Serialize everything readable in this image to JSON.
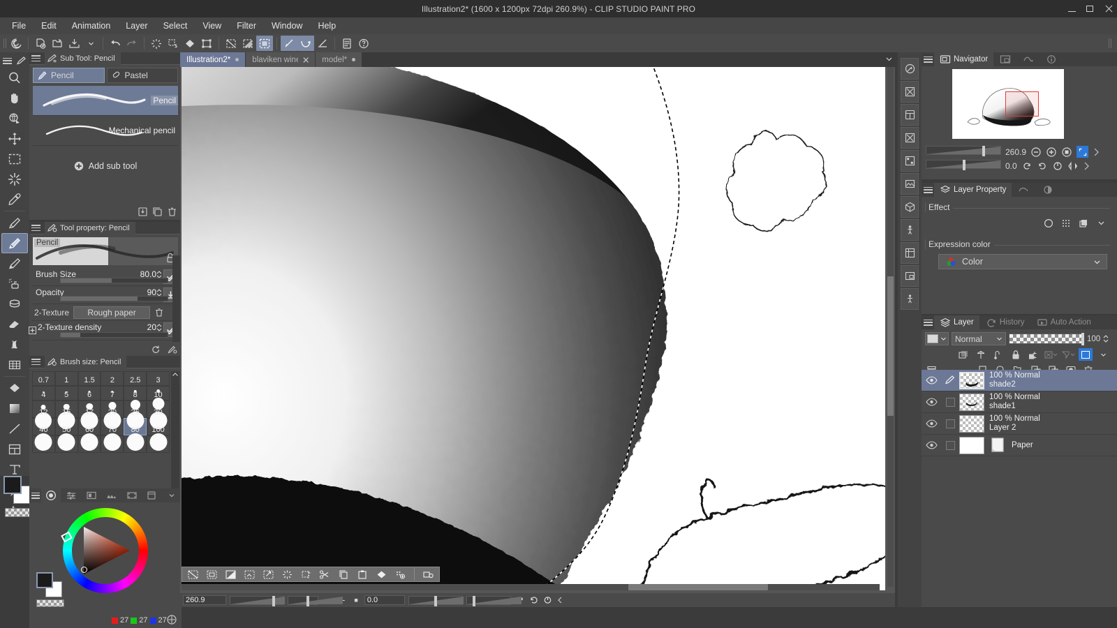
{
  "window": {
    "title": "Illustration2* (1600 x 1200px 72dpi 260.9%)  - CLIP STUDIO PAINT PRO",
    "minimize": "minimize-button",
    "maximize": "maximize-button",
    "close": "close-button"
  },
  "menu": {
    "items": [
      "File",
      "Edit",
      "Animation",
      "Layer",
      "Select",
      "View",
      "Filter",
      "Window",
      "Help"
    ]
  },
  "command_bar": {
    "buttons": [
      {
        "name": "clip-studio-button",
        "icon": "spiral-icon"
      },
      {
        "name": "new-button",
        "icon": "new-doc-icon"
      },
      {
        "name": "open-button",
        "icon": "folder-open-icon"
      },
      {
        "name": "save-button",
        "icon": "save-icon"
      },
      {
        "name": "save-dropdown",
        "icon": "chevron-down-icon"
      },
      {
        "name": "undo-button",
        "icon": "undo-icon"
      },
      {
        "name": "redo-button",
        "icon": "redo-icon"
      },
      {
        "name": "clear-button",
        "icon": "burst-icon"
      },
      {
        "name": "fill-selection-button",
        "icon": "fill-select-icon"
      },
      {
        "name": "fill-button",
        "icon": "diamond-fill-icon"
      },
      {
        "name": "scale-rotate-button",
        "icon": "transform-icon"
      },
      {
        "name": "deselect-button",
        "icon": "deselect-icon"
      },
      {
        "name": "invert-selection-button",
        "icon": "invert-select-icon"
      },
      {
        "name": "select-border-button",
        "icon": "select-border-icon"
      },
      {
        "name": "snap-ruler-button",
        "icon": "snap-ruler-icon"
      },
      {
        "name": "snap-curve-button",
        "icon": "snap-curve-icon"
      },
      {
        "name": "snap-perspective-button",
        "icon": "snap-perspective-icon"
      },
      {
        "name": "grid-button",
        "icon": "grid-icon"
      },
      {
        "name": "help-button",
        "icon": "question-icon"
      }
    ]
  },
  "tools": {
    "header_label": "tool-palette",
    "items": [
      {
        "name": "magnifier-tool",
        "icon": "magnifier-icon"
      },
      {
        "name": "move-layer-tool",
        "icon": "hand-icon"
      },
      {
        "name": "rotate-tool",
        "icon": "rotate-icon"
      },
      {
        "name": "move-tool",
        "icon": "move-arrows-icon"
      },
      {
        "name": "selection-tool",
        "icon": "marquee-icon"
      },
      {
        "name": "auto-select-tool",
        "icon": "magic-wand-icon"
      },
      {
        "name": "eyedropper-tool",
        "icon": "eyedropper-icon"
      },
      {
        "name": "pen-tool",
        "icon": "pen-icon"
      },
      {
        "name": "pencil-tool",
        "icon": "pencil-icon",
        "selected": true
      },
      {
        "name": "brush-tool",
        "icon": "brush-icon"
      },
      {
        "name": "airbrush-tool",
        "icon": "airbrush-icon"
      },
      {
        "name": "decoration-tool",
        "icon": "decoration-icon"
      },
      {
        "name": "eraser-tool",
        "icon": "eraser-icon"
      },
      {
        "name": "blend-tool",
        "icon": "blend-icon"
      },
      {
        "name": "gradient-tool",
        "icon": "gradient-grid-icon"
      },
      {
        "name": "fill-tool",
        "icon": "fill-bucket-icon"
      },
      {
        "name": "gradation-tool",
        "icon": "gradation-icon"
      },
      {
        "name": "figure-tool",
        "icon": "line-icon"
      },
      {
        "name": "frame-border-tool",
        "icon": "frame-icon"
      },
      {
        "name": "text-tool",
        "icon": "text-icon"
      },
      {
        "name": "balloon-tool",
        "icon": "balloon-icon"
      },
      {
        "name": "correct-line-tool",
        "icon": "correct-line-icon"
      }
    ]
  },
  "sub_tool": {
    "title": "Sub Tool: Pencil",
    "tabs": [
      {
        "label": "Pencil",
        "icon": "pencil-icon",
        "active": true
      },
      {
        "label": "Pastel",
        "icon": "pastel-icon",
        "active": false
      }
    ],
    "list": [
      {
        "label": "Pencil",
        "selected": true
      },
      {
        "label": "Mechanical pencil",
        "selected": false
      }
    ],
    "add_label": "Add sub tool",
    "footer": [
      {
        "name": "import-subtool-button",
        "icon": "import-icon"
      },
      {
        "name": "duplicate-subtool-button",
        "icon": "duplicate-icon"
      },
      {
        "name": "delete-subtool-button",
        "icon": "trash-icon"
      }
    ]
  },
  "tool_property": {
    "title": "Tool property: Pencil",
    "preview_label": "Pencil",
    "rows": [
      {
        "name": "Brush Size",
        "value": "80.0",
        "fill_pct": 48
      },
      {
        "name": "Opacity",
        "value": "90",
        "fill_pct": 72
      }
    ],
    "texture_label": "2-Texture",
    "texture_value": "Rough paper",
    "density_label": "2-Texture density",
    "density_value": "20",
    "density_fill_pct": 18
  },
  "brush_size": {
    "title": "Brush size: Pencil",
    "rows": [
      {
        "values": [
          "0.7",
          "1",
          "1.5",
          "2",
          "2.5",
          "3"
        ],
        "dots": [
          0,
          0,
          0,
          0,
          0,
          0
        ]
      },
      {
        "values": [
          "4",
          "5",
          "6",
          "7",
          "8",
          "10"
        ],
        "dots": [
          2,
          2.5,
          3,
          3.5,
          4.5,
          5.5
        ]
      },
      {
        "values": [
          "12",
          "15",
          "17",
          "20",
          "25",
          "30"
        ],
        "dots": [
          7,
          8.5,
          9.5,
          11,
          14,
          17
        ]
      },
      {
        "values": [
          "40",
          "50",
          "60",
          "70",
          "80",
          "100"
        ],
        "dots": [
          21,
          22,
          22,
          22,
          22,
          22
        ]
      },
      {
        "values": [
          "",
          "",
          "",
          "",
          "",
          ""
        ],
        "dots": [
          22,
          22,
          22,
          22,
          22,
          22
        ]
      }
    ],
    "selected": "80"
  },
  "color_wheel": {
    "tabs": [
      {
        "name": "color-wheel-tab",
        "icon": "color-wheel-icon",
        "active": true
      },
      {
        "name": "color-slider-tab",
        "icon": "sliders-icon",
        "active": false
      },
      {
        "name": "color-set-tab",
        "icon": "color-set-icon",
        "active": false
      },
      {
        "name": "gradient-tab",
        "icon": "mountain-icon",
        "active": false
      },
      {
        "name": "color-history-tab",
        "icon": "filmstrip-icon",
        "active": false
      },
      {
        "name": "material-tab",
        "icon": "material-icon",
        "active": false
      }
    ],
    "rgb": {
      "r": "27",
      "g": "27",
      "b": "27"
    },
    "foreground_color": "#1b1b1b",
    "background_color": "#ffffff"
  },
  "document_tabs": [
    {
      "label": "Illustration2*",
      "active": true,
      "modified": true,
      "closable": false
    },
    {
      "label": "blaviken wine.p",
      "active": false,
      "modified": false,
      "closable": true
    },
    {
      "label": "model*",
      "active": false,
      "modified": true,
      "closable": false
    }
  ],
  "selection_launcher": [
    {
      "name": "deselect-button",
      "icon": "deselect-icon"
    },
    {
      "name": "invert-selection-button",
      "icon": "invert-icon"
    },
    {
      "name": "shrink-expand-button",
      "icon": "shrink-icon"
    },
    {
      "name": "crop-button",
      "icon": "crop-icon"
    },
    {
      "name": "scale-up-button",
      "icon": "scale-icon"
    },
    {
      "name": "blur-button",
      "icon": "burst-icon"
    },
    {
      "name": "erase-button",
      "icon": "erase-icon"
    },
    {
      "name": "cut-button",
      "icon": "scissors-icon"
    },
    {
      "name": "copy-button",
      "icon": "copy-icon"
    },
    {
      "name": "paste-button",
      "icon": "paste-icon"
    },
    {
      "name": "fill-button",
      "icon": "diamond-icon"
    },
    {
      "name": "add-tone-button",
      "icon": "tone-icon"
    },
    {
      "name": "settings-button",
      "icon": "gear-icon"
    }
  ],
  "status_bar": {
    "zoom": "260.9",
    "rotation": "0.0",
    "zoom_out": "−",
    "zoom_in": "+",
    "zoom_reset": "■"
  },
  "right_strip": [
    {
      "name": "quick-access-button",
      "icon": "quick-access-icon"
    },
    {
      "name": "material-download-button",
      "icon": "material-dl-icon"
    },
    {
      "name": "material-manga-button",
      "icon": "material-manga-icon"
    },
    {
      "name": "material-monochrome-button",
      "icon": "material-mono-icon"
    },
    {
      "name": "material-color-button",
      "icon": "material-color-icon"
    },
    {
      "name": "material-image-button",
      "icon": "material-image-icon"
    },
    {
      "name": "material-3d-button",
      "icon": "material-3d-icon"
    },
    {
      "name": "material-pose-button",
      "icon": "material-pose-icon"
    },
    {
      "name": "material-all-button",
      "icon": "material-all-icon"
    },
    {
      "name": "sub-view-button",
      "icon": "sub-view-icon"
    },
    {
      "name": "pose-scanner-button",
      "icon": "pose-scanner-icon"
    }
  ],
  "navigator": {
    "tabs": [
      {
        "label": "Navigator",
        "active": true,
        "icon": "navigator-icon"
      },
      {
        "label": "",
        "active": false,
        "icon": "sub-view-icon"
      },
      {
        "label": "",
        "active": false,
        "icon": "timelapse-icon"
      },
      {
        "label": "",
        "active": false,
        "icon": "info-icon"
      }
    ],
    "zoom": "260.9",
    "rotation": "0.0",
    "controls": [
      {
        "name": "zoom-out-button",
        "icon": "minus-circle-icon"
      },
      {
        "name": "zoom-in-button",
        "icon": "plus-circle-icon"
      },
      {
        "name": "fit-button",
        "icon": "fit-icon"
      },
      {
        "name": "full-button",
        "icon": "full-icon"
      },
      {
        "name": "rotate-left-button",
        "icon": "rotate-left-icon"
      },
      {
        "name": "rotate-right-button",
        "icon": "rotate-right-icon"
      },
      {
        "name": "rotate-reset-button",
        "icon": "rotate-reset-icon"
      },
      {
        "name": "flip-button",
        "icon": "flip-icon"
      }
    ]
  },
  "layer_property": {
    "tabs": [
      {
        "label": "Layer Property",
        "active": true,
        "icon": "layer-property-icon"
      },
      {
        "label": "",
        "active": false,
        "icon": "animation-cels-icon"
      },
      {
        "label": "",
        "active": false,
        "icon": "color-mode-icon"
      }
    ],
    "effect_label": "Effect",
    "effect_buttons": [
      {
        "name": "border-effect-button",
        "icon": "circle-icon"
      },
      {
        "name": "tone-effect-button",
        "icon": "halftone-icon"
      },
      {
        "name": "layer-color-button",
        "icon": "layer-color-icon"
      },
      {
        "name": "effect-more-button",
        "icon": "chevron-down-icon"
      }
    ],
    "expression_label": "Expression color",
    "expression_value": "Color"
  },
  "layers": {
    "tabs": [
      {
        "label": "Layer",
        "active": true,
        "icon": "layers-icon"
      },
      {
        "label": "History",
        "active": false,
        "icon": "history-icon"
      },
      {
        "label": "Auto Action",
        "active": false,
        "icon": "auto-action-icon"
      }
    ],
    "blend_mode": "Normal",
    "opacity": "100",
    "toolbar_icons": [
      {
        "name": "clip-to-layer-button",
        "icon": "clip-layer-icon"
      },
      {
        "name": "mask-enable-button",
        "icon": "mask-icon"
      },
      {
        "name": "ruler-range-button",
        "icon": "ruler-range-icon"
      },
      {
        "name": "lock-layer-button",
        "icon": "lock-icon"
      },
      {
        "name": "lock-transparent-button",
        "icon": "lock-transparent-icon"
      },
      {
        "name": "mask-apply-button",
        "icon": "mask-apply-icon"
      },
      {
        "name": "mask-delete-button",
        "icon": "mask-delete-icon"
      },
      {
        "name": "palette-color-button",
        "icon": "palette-color-icon"
      }
    ],
    "toolbar_icons2": [
      {
        "name": "layer-list-button",
        "icon": "layer-list-icon"
      },
      {
        "name": "new-raster-layer-button",
        "icon": "new-raster-icon"
      },
      {
        "name": "new-vector-layer-button",
        "icon": "new-vector-icon"
      },
      {
        "name": "new-folder-button",
        "icon": "new-folder-icon"
      },
      {
        "name": "transfer-down-button",
        "icon": "transfer-down-icon"
      },
      {
        "name": "combine-down-button",
        "icon": "combine-down-icon"
      },
      {
        "name": "create-mask-button",
        "icon": "create-mask-icon"
      },
      {
        "name": "delete-layer-button",
        "icon": "trash-icon"
      }
    ],
    "rows": [
      {
        "mode": "100 % Normal",
        "name": "shade2",
        "selected": true,
        "visible": true,
        "has_draw_icon": true
      },
      {
        "mode": "100 % Normal",
        "name": "shade1",
        "selected": false,
        "visible": true,
        "has_draw_icon": false
      },
      {
        "mode": "100 % Normal",
        "name": "Layer 2",
        "selected": false,
        "visible": true,
        "has_draw_icon": false
      },
      {
        "mode": "",
        "name": "Paper",
        "selected": false,
        "visible": true,
        "has_draw_icon": false
      }
    ]
  }
}
